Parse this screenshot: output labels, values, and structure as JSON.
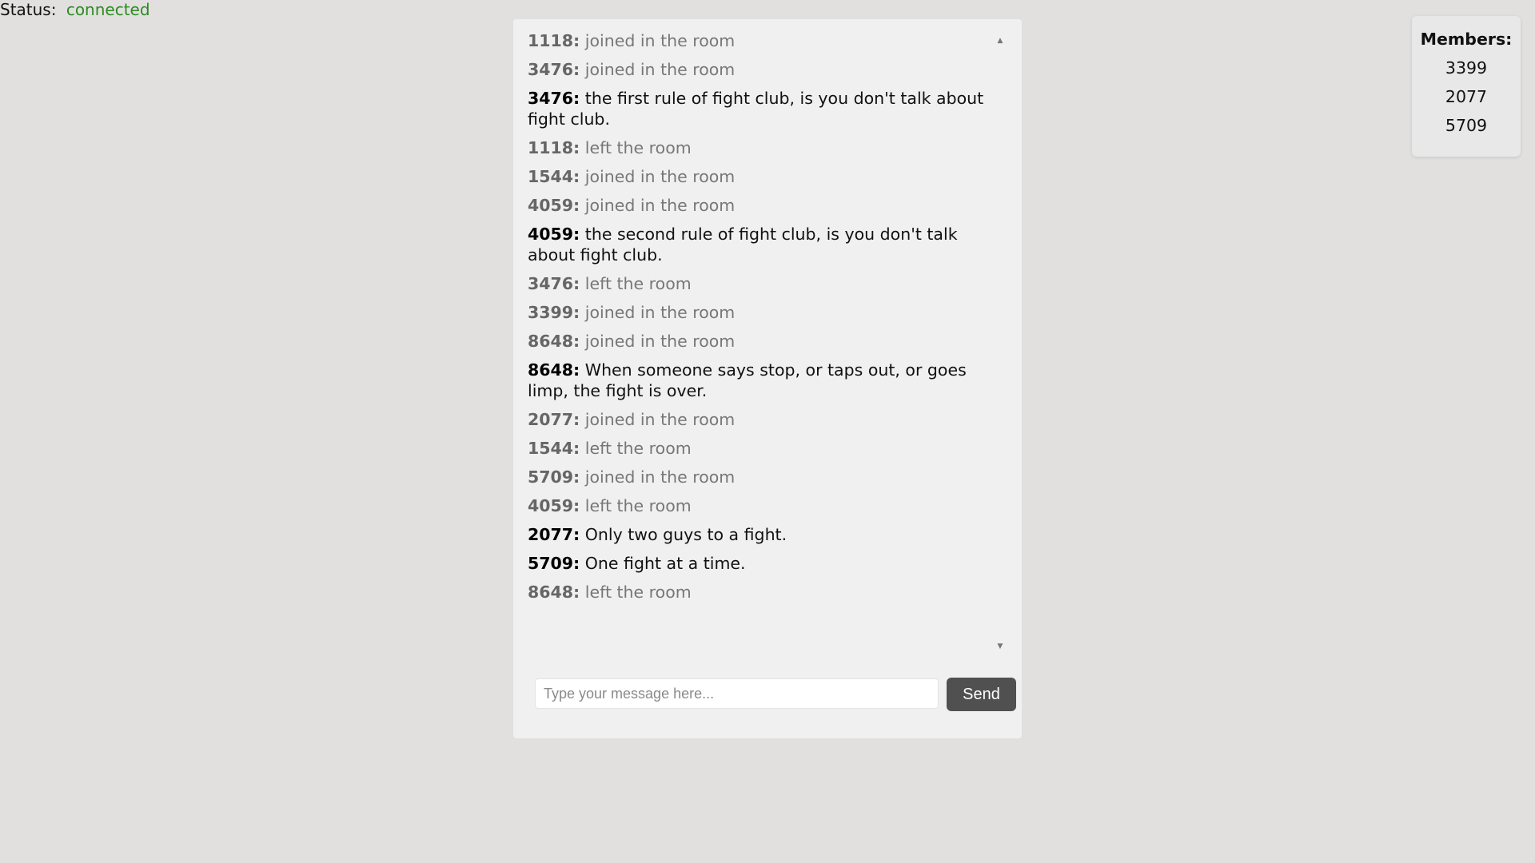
{
  "status": {
    "label": "Status:",
    "value": "connected",
    "color": "#2e8b22"
  },
  "chat": {
    "messages": [
      {
        "author": "1118:",
        "text": "joined in the room",
        "kind": "event"
      },
      {
        "author": "3476:",
        "text": "joined in the room",
        "kind": "event"
      },
      {
        "author": "3476:",
        "text": "the first rule of fight club, is you don't talk about fight club.",
        "kind": "chat"
      },
      {
        "author": "1118:",
        "text": "left the room",
        "kind": "event"
      },
      {
        "author": "1544:",
        "text": "joined in the room",
        "kind": "event"
      },
      {
        "author": "4059:",
        "text": "joined in the room",
        "kind": "event"
      },
      {
        "author": "4059:",
        "text": "the second rule of fight club, is you don't talk about fight club.",
        "kind": "chat"
      },
      {
        "author": "3476:",
        "text": "left the room",
        "kind": "event"
      },
      {
        "author": "3399:",
        "text": "joined in the room",
        "kind": "event"
      },
      {
        "author": "8648:",
        "text": "joined in the room",
        "kind": "event"
      },
      {
        "author": "8648:",
        "text": "When someone says stop, or taps out, or goes limp, the fight is over.",
        "kind": "chat"
      },
      {
        "author": "2077:",
        "text": "joined in the room",
        "kind": "event"
      },
      {
        "author": "1544:",
        "text": "left the room",
        "kind": "event"
      },
      {
        "author": "5709:",
        "text": "joined in the room",
        "kind": "event"
      },
      {
        "author": "4059:",
        "text": "left the room",
        "kind": "event"
      },
      {
        "author": "2077:",
        "text": "Only two guys to a fight.",
        "kind": "chat"
      },
      {
        "author": "5709:",
        "text": "One fight at a time.",
        "kind": "chat"
      },
      {
        "author": "8648:",
        "text": "left the room",
        "kind": "event"
      }
    ],
    "scroll_up_icon": "arrow-up-icon",
    "scroll_down_icon": "arrow-down-icon"
  },
  "composer": {
    "input_value": "",
    "input_placeholder": "Type your message here...",
    "send_label": "Send"
  },
  "members": {
    "title": "Members:",
    "list": [
      "3399",
      "2077",
      "5709"
    ]
  }
}
